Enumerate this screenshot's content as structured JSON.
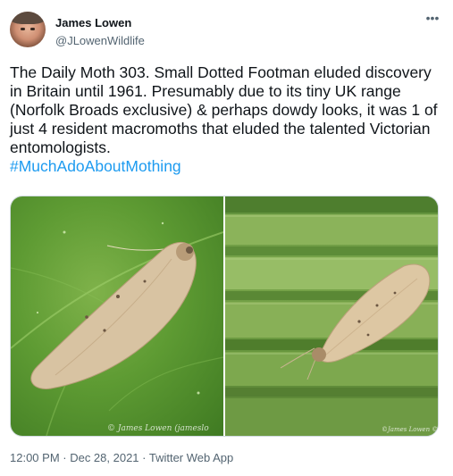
{
  "author": {
    "name": "James Lowen",
    "handle": "@JLowenWildlife"
  },
  "tweet": {
    "text_before": "The Daily Moth 303. Small Dotted Footman eluded discovery in Britain until 1961. Presumably due to its tiny UK range (Norfolk Broads exclusive) & perhaps dowdy looks, it was 1 of just 4 resident macromoths that eluded the talented Victorian entomologists.",
    "hashtag": "#MuchAdoAboutMothing",
    "timestamp": "12:00 PM · Dec 28, 2021 · Twitter Web App"
  },
  "media": {
    "left_credit": "© James Lowen (jameslo",
    "right_credit": "©James Lowen ©"
  },
  "icons": {
    "more": "more-horizontal-icon"
  },
  "colors": {
    "link": "#1d9bf0",
    "secondary_text": "#536471"
  }
}
